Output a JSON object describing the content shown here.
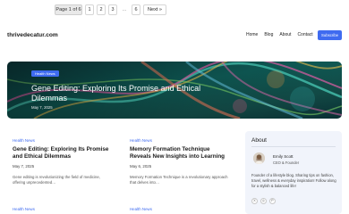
{
  "pagination": {
    "label": "Page 1 of 6",
    "pages": [
      "1",
      "2",
      "3"
    ],
    "ellipsis": "…",
    "last": "6",
    "next": "Next »"
  },
  "header": {
    "site_title": "thrivedecatur.com",
    "nav": [
      "Home",
      "Blog",
      "About",
      "Contact"
    ],
    "subscribe": "Subscribe"
  },
  "hero": {
    "category": "Health News",
    "title": "Gene Editing: Exploring Its Promise and Ethical Dilemmas",
    "date": "May 7, 2025"
  },
  "posts": [
    {
      "category": "Health News",
      "title": "Gene Editing: Exploring Its Promise and Ethical Dilemmas",
      "date": "May 7, 2025",
      "excerpt": "Gene editing is revolutionizing the field of medicine, offering unprecedented…"
    },
    {
      "category": "Health News",
      "title": "Memory Formation Technique Reveals New Insights into Learning",
      "date": "May 6, 2025",
      "excerpt": "Memory Formation Technique is a revolutionary approach that delves into…"
    }
  ],
  "bottom_categories": [
    "Health News",
    "Health News"
  ],
  "about": {
    "heading": "About",
    "name": "Emily Scott",
    "role": "CEO & Founder",
    "text": "Founder of a lifestyle blog. Sharing tips on fashion, travel, wellness & everyday inspiration! Follow along for a stylish & balanced life!",
    "socials": [
      {
        "icon": "x-icon",
        "glyph": "X"
      },
      {
        "icon": "instagram-icon",
        "glyph": "◎"
      },
      {
        "icon": "pinterest-icon",
        "glyph": "P"
      }
    ]
  },
  "colors": {
    "accent": "#3f6bf0",
    "about_bg": "#f1f4fb"
  }
}
